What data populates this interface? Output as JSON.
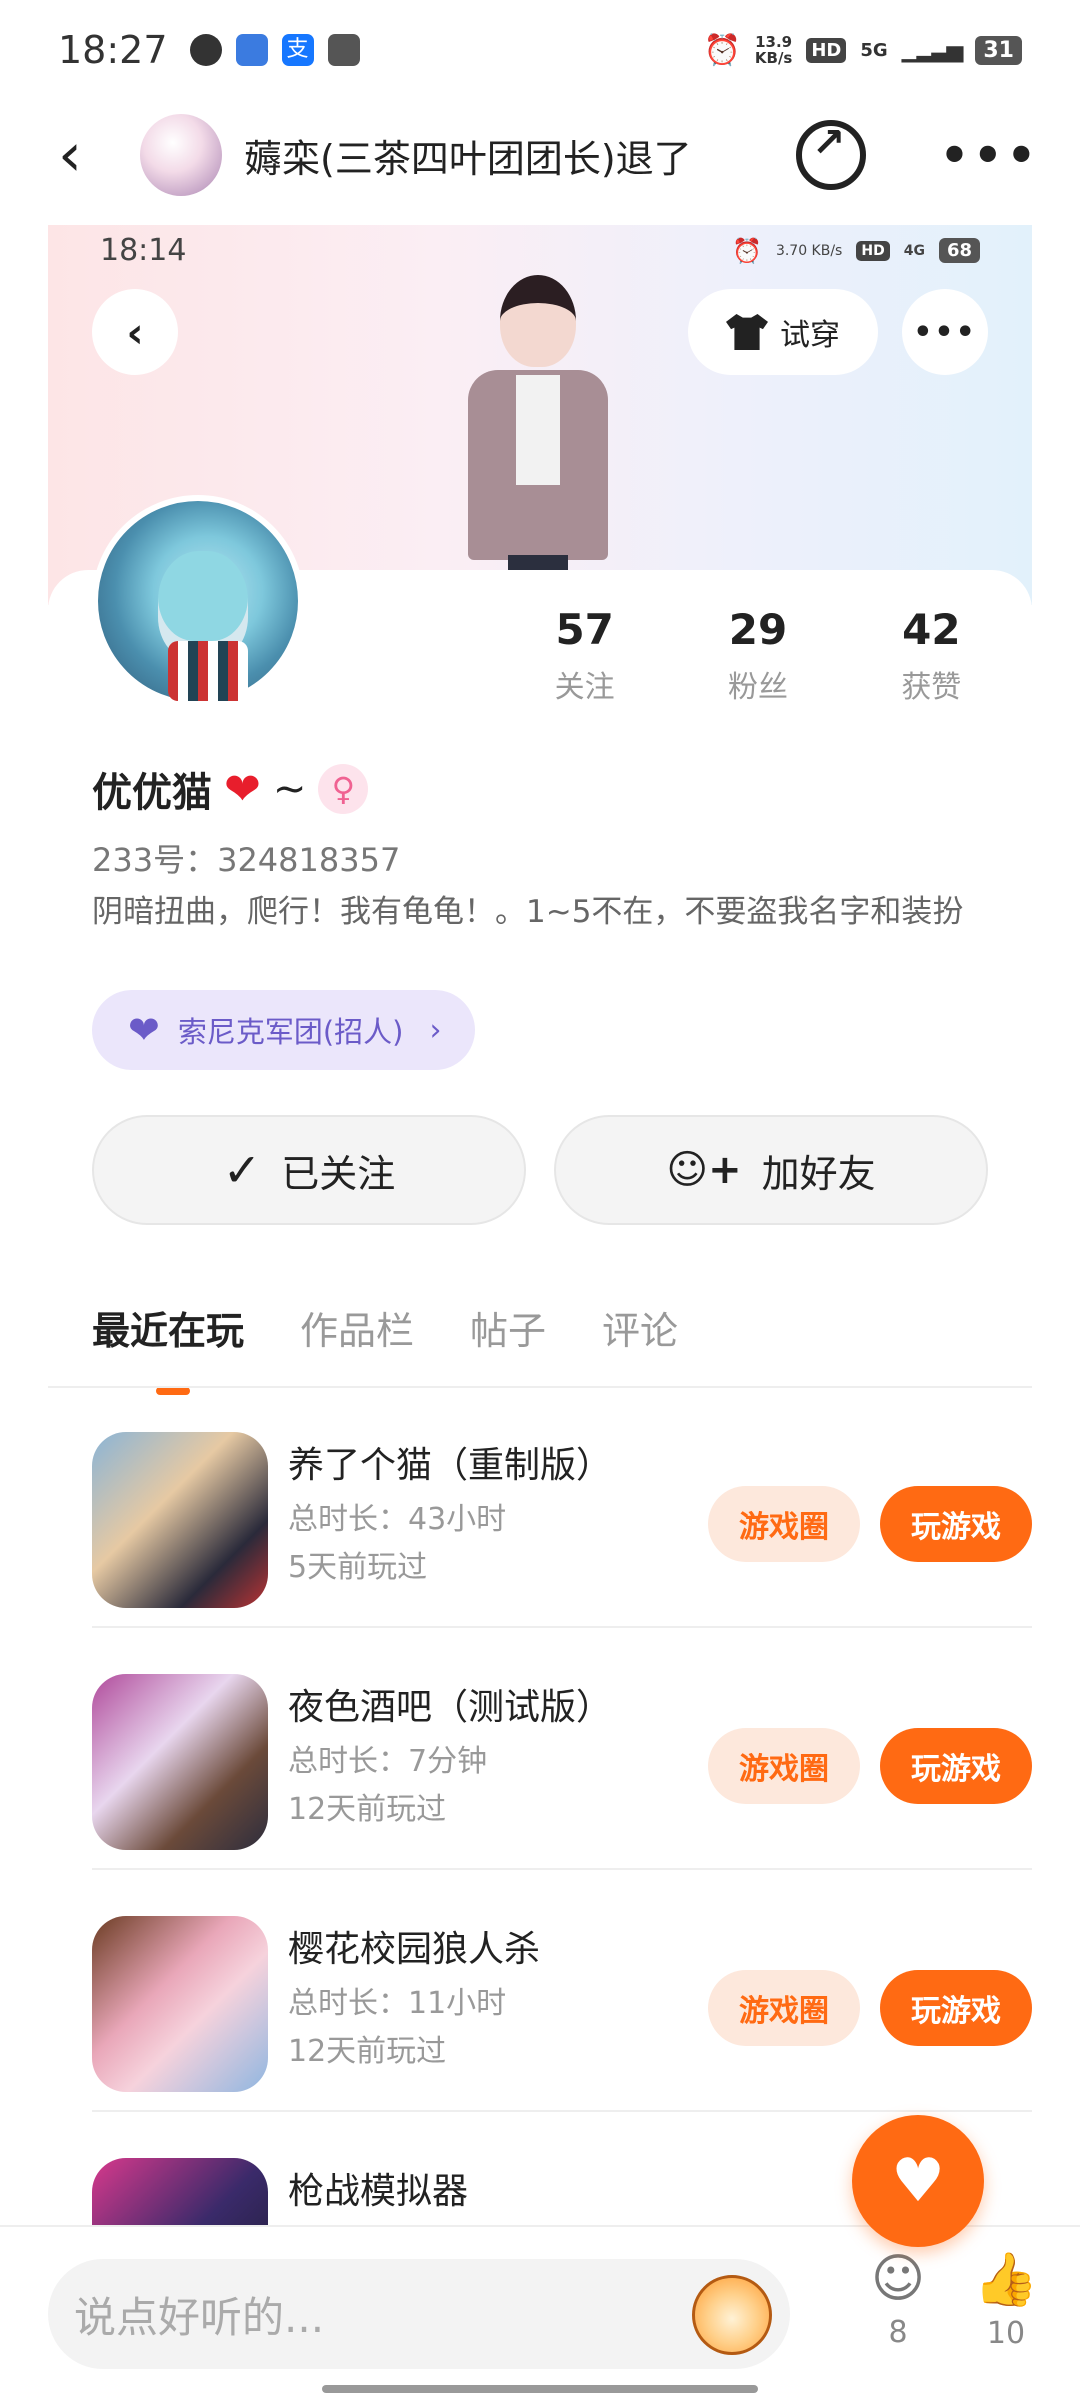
{
  "status_bar": {
    "time": "18:27",
    "net_speed": "13.9\nKB/s",
    "hd": "HD",
    "network": "5G",
    "battery": "31"
  },
  "topbar": {
    "title": "薅栾(三茶四叶团团长)退了"
  },
  "inner_status": {
    "time": "18:14",
    "net_speed": "3.70 KB/s",
    "hd": "HD",
    "network": "4G",
    "battery": "68"
  },
  "banner": {
    "tryon_label": "试穿"
  },
  "profile": {
    "stats": [
      {
        "value": "57",
        "label": "关注"
      },
      {
        "value": "29",
        "label": "粉丝"
      },
      {
        "value": "42",
        "label": "获赞"
      }
    ],
    "username": "优优猫",
    "username_suffix": "~",
    "uid": "233号：324818357",
    "bio": "阴暗扭曲，爬行！我有龟龟！。1~5不在，不要盗我名字和装扮",
    "group_label": "索尼克军团(招人)",
    "follow_label": "已关注",
    "add_friend_label": "加好友"
  },
  "tabs": [
    {
      "label": "最近在玩"
    },
    {
      "label": "作品栏"
    },
    {
      "label": "帖子"
    },
    {
      "label": "评论"
    }
  ],
  "games": [
    {
      "name": "养了个猫（重制版）",
      "duration": "总时长：43小时",
      "last_played": "5天前玩过",
      "circle_label": "游戏圈",
      "play_label": "玩游戏"
    },
    {
      "name": "夜色酒吧（测试版）",
      "duration": "总时长：7分钟",
      "last_played": "12天前玩过",
      "circle_label": "游戏圈",
      "play_label": "玩游戏"
    },
    {
      "name": "樱花校园狼人杀",
      "duration": "总时长：11小时",
      "last_played": "12天前玩过",
      "circle_label": "游戏圈",
      "play_label": "玩游戏"
    },
    {
      "name": "枪战模拟器"
    }
  ],
  "bottom_bar": {
    "comment_placeholder": "说点好听的...",
    "comment_count": "8",
    "like_count": "10"
  },
  "colors": {
    "accent": "#ff6a13",
    "group_purple": "#6b5bc8"
  }
}
